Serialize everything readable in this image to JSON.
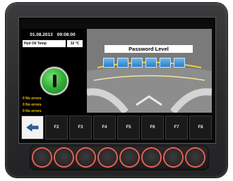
{
  "header": {
    "date": "01.08.2013",
    "time": "09:08:00"
  },
  "sensor": {
    "label": "Hyd Oil Temp",
    "value": "32 °C"
  },
  "status": {
    "errors": [
      "0 No errors",
      "0 No errors",
      "0 No errors"
    ]
  },
  "password": {
    "title": "Password Level",
    "slots": 6
  },
  "function_keys": [
    "F2",
    "F3",
    "F4",
    "F5",
    "F6",
    "F7",
    "F8"
  ],
  "back_button": {
    "icon": "arrow-left-icon"
  },
  "hardware_buttons": {
    "count": 8,
    "ring_color": "#e2645a"
  }
}
